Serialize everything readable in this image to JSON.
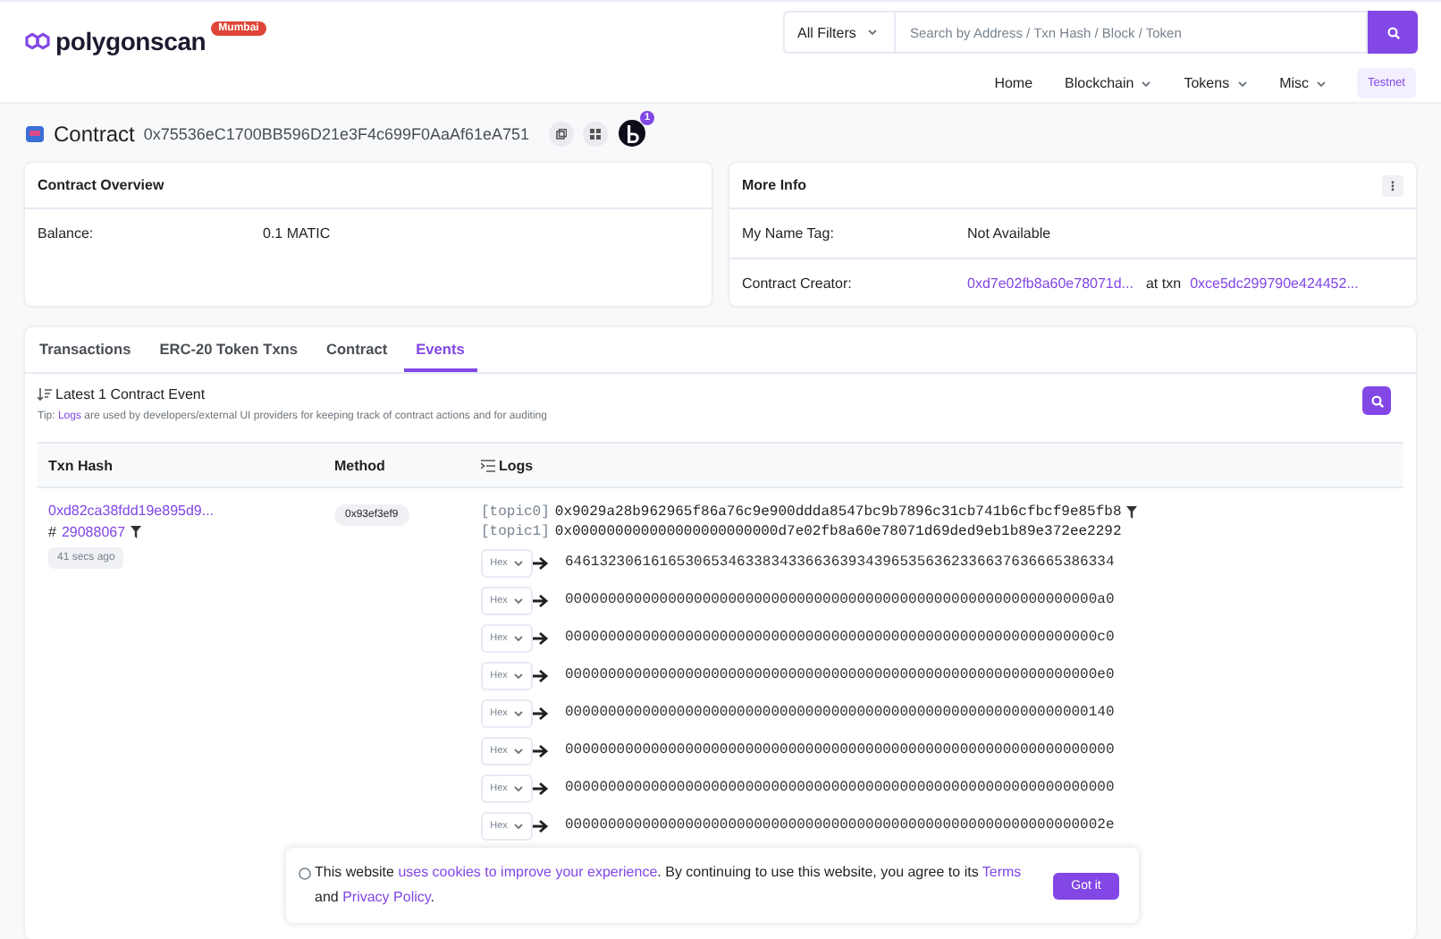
{
  "header": {
    "logo_text": "polygonscan",
    "network_badge": "Mumbai",
    "search": {
      "filter": "All Filters",
      "placeholder": "Search by Address / Txn Hash / Block / Token"
    },
    "nav": [
      {
        "label": "Home",
        "dropdown": false
      },
      {
        "label": "Blockchain",
        "dropdown": true
      },
      {
        "label": "Tokens",
        "dropdown": true
      },
      {
        "label": "Misc",
        "dropdown": true
      }
    ],
    "testnet": "Testnet"
  },
  "contract": {
    "label": "Contract",
    "address": "0x75536eC1700BB596D21e3F4c699F0AaAf61eA751",
    "notification_count": "1"
  },
  "overview": {
    "title": "Contract Overview",
    "rows": [
      {
        "label": "Balance:",
        "value": "0.1 MATIC"
      }
    ]
  },
  "more_info": {
    "title": "More Info",
    "name_tag": {
      "label": "My Name Tag:",
      "value": "Not Available"
    },
    "creator": {
      "label": "Contract Creator:",
      "address": "0xd7e02fb8a60e78071d...",
      "at": "at txn",
      "txn": "0xce5dc299790e424452..."
    }
  },
  "tabs": [
    {
      "label": "Transactions",
      "selected": false
    },
    {
      "label": "ERC-20 Token Txns",
      "selected": false
    },
    {
      "label": "Contract",
      "selected": false
    },
    {
      "label": "Events",
      "selected": true
    }
  ],
  "events": {
    "heading": "Latest 1 Contract Event",
    "tip": {
      "prefix": "Tip:",
      "link": "Logs",
      "text": "are used by developers/external UI providers for keeping track of contract actions and for auditing"
    }
  },
  "table": {
    "columns": [
      "Txn Hash",
      "Method",
      "Logs"
    ],
    "rows": [
      {
        "txn_hash": "0xd82ca38fdd19e895d9...",
        "block_prefix": "#",
        "block": "29088067",
        "age": "41 secs ago",
        "method": "0x93ef3ef9",
        "topics": [
          {
            "label": "[topic0]",
            "value": "0x9029a28b962965f86a76c9e900ddda8547bc9b7896c31cb741b6cfbcf9e85fb8",
            "filter": true
          },
          {
            "label": "[topic1]",
            "value": "0x000000000000000000000000d7e02fb8a60e78071d69ded9eb1b89e372ee2292",
            "filter": false
          }
        ],
        "data": [
          {
            "format": "Hex",
            "value": "6461323061616530653463383433663639343965356362336637636665386334"
          },
          {
            "format": "Hex",
            "value": "00000000000000000000000000000000000000000000000000000000000000a0"
          },
          {
            "format": "Hex",
            "value": "00000000000000000000000000000000000000000000000000000000000000c0"
          },
          {
            "format": "Hex",
            "value": "00000000000000000000000000000000000000000000000000000000000000e0"
          },
          {
            "format": "Hex",
            "value": "0000000000000000000000000000000000000000000000000000000000000140"
          },
          {
            "format": "Hex",
            "value": "0000000000000000000000000000000000000000000000000000000000000000"
          },
          {
            "format": "Hex",
            "value": "0000000000000000000000000000000000000000000000000000000000000000"
          },
          {
            "format": "Hex",
            "value": "000000000000000000000000000000000000000000000000000000000000002e"
          }
        ]
      }
    ]
  },
  "cookie": {
    "parts": [
      {
        "text": "This website ",
        "link": false
      },
      {
        "text": "uses cookies to improve your experience",
        "link": true
      },
      {
        "text": ". By continuing to use this website, you agree to its ",
        "link": false
      },
      {
        "text": "Terms",
        "link": true
      },
      {
        "text": " and ",
        "link": false
      },
      {
        "text": "Privacy Policy",
        "link": true
      },
      {
        "text": ".",
        "link": false
      }
    ],
    "button": "Got it"
  }
}
